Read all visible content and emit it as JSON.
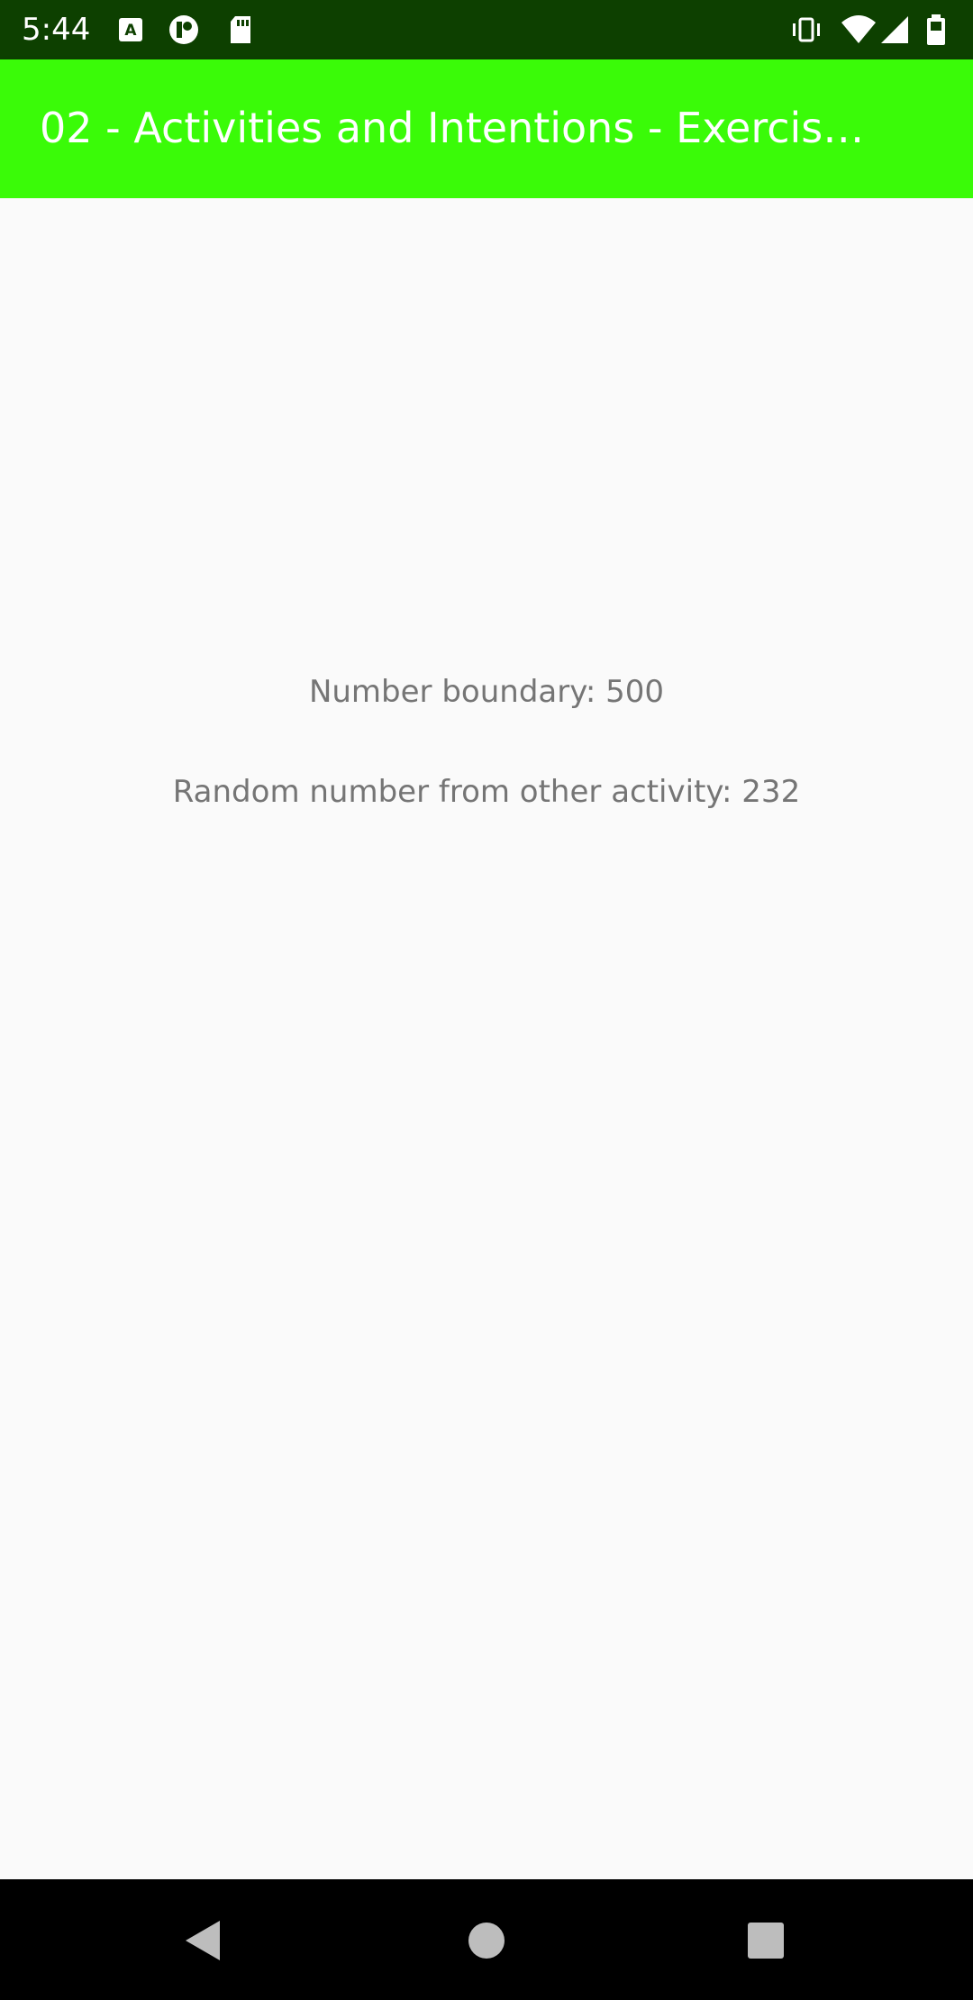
{
  "status_bar": {
    "time": "5:44",
    "icons_left": [
      "a-box-icon",
      "recording-icon",
      "sd-card-icon"
    ],
    "icons_right": [
      "vibrate-icon",
      "wifi-icon",
      "signal-icon",
      "battery-icon"
    ]
  },
  "app_bar": {
    "title": "02 - Activities and Intentions - Exercis…",
    "color": "#3afb08"
  },
  "main": {
    "number_boundary": "Number boundary: 500",
    "random_number": "Random number from other activity: 232"
  },
  "nav_bar": {
    "buttons": [
      "back-icon",
      "home-icon",
      "recents-icon"
    ]
  }
}
